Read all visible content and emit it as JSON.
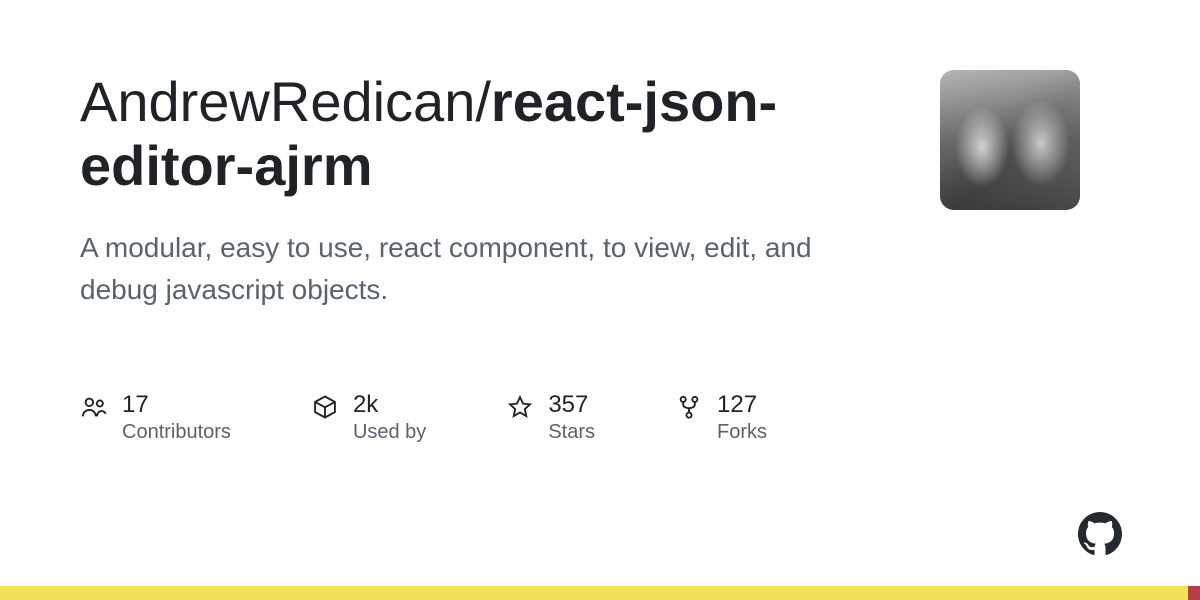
{
  "repo": {
    "owner": "AndrewRedican",
    "separator": "/",
    "name": "react-json-editor-ajrm"
  },
  "description": "A modular, easy to use, react component, to view, edit, and debug javascript objects.",
  "stats": {
    "contributors": {
      "value": "17",
      "label": "Contributors"
    },
    "usedby": {
      "value": "2k",
      "label": "Used by"
    },
    "stars": {
      "value": "357",
      "label": "Stars"
    },
    "forks": {
      "value": "127",
      "label": "Forks"
    }
  },
  "language_bar": {
    "segments": [
      {
        "color_class": "seg-yellow",
        "pct": 99.0
      },
      {
        "color_class": "seg-red",
        "pct": 1.0
      }
    ]
  }
}
